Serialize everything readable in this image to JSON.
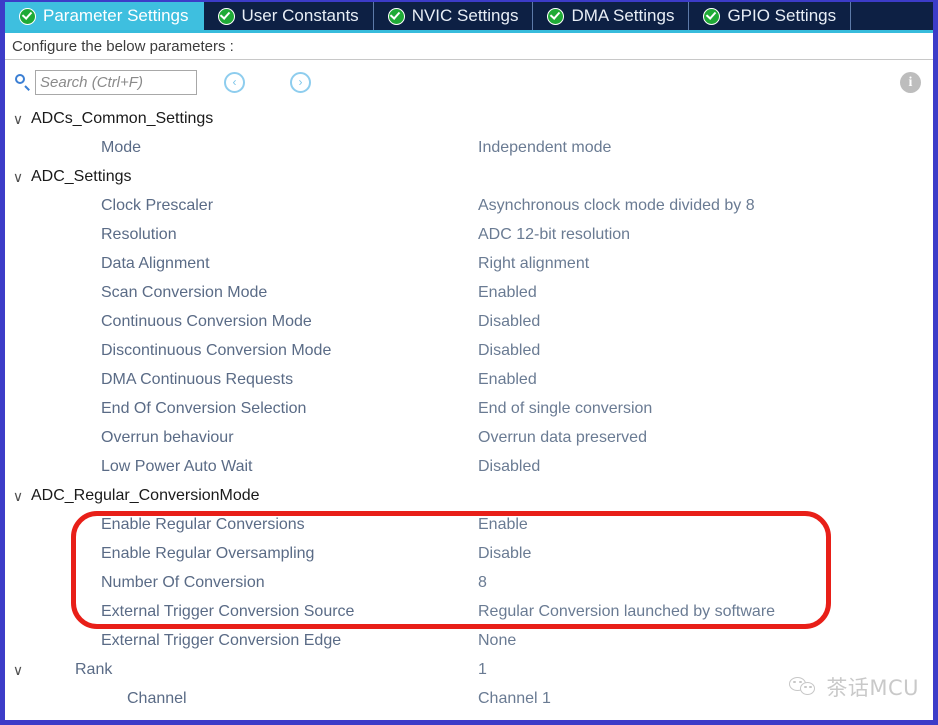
{
  "colors": {
    "active_tab_bg": "#3ebfdf",
    "tabbar_bg": "#0d2044",
    "window_border": "#3c3cc8",
    "annotation": "#e81f18",
    "group_label": "#1a1a1a",
    "child_label": "#5a6b86",
    "value_text": "#6a7b93"
  },
  "tabs": [
    {
      "label": "Parameter Settings",
      "icon": "check-circle-icon",
      "active": true
    },
    {
      "label": "User Constants",
      "icon": "check-circle-icon",
      "active": false
    },
    {
      "label": "NVIC Settings",
      "icon": "check-circle-icon",
      "active": false
    },
    {
      "label": "DMA Settings",
      "icon": "check-circle-icon",
      "active": false
    },
    {
      "label": "GPIO Settings",
      "icon": "check-circle-icon",
      "active": false
    }
  ],
  "configure": {
    "text": "Configure the below parameters :"
  },
  "search": {
    "placeholder": "Search (Ctrl+F)",
    "value": "",
    "icon": "search-icon",
    "prev_glyph": "‹",
    "next_glyph": "›",
    "info_glyph": "i"
  },
  "tree": [
    {
      "kind": "group",
      "label": "ADCs_Common_Settings",
      "chevron": "∨",
      "value": ""
    },
    {
      "kind": "child",
      "label": "Mode",
      "chevron": "",
      "value": "Independent mode"
    },
    {
      "kind": "group",
      "label": "ADC_Settings",
      "chevron": "∨",
      "value": ""
    },
    {
      "kind": "child",
      "label": "Clock Prescaler",
      "chevron": "",
      "value": "Asynchronous clock mode divided by 8"
    },
    {
      "kind": "child",
      "label": "Resolution",
      "chevron": "",
      "value": "ADC 12-bit resolution"
    },
    {
      "kind": "child",
      "label": "Data Alignment",
      "chevron": "",
      "value": "Right alignment"
    },
    {
      "kind": "child",
      "label": "Scan Conversion Mode",
      "chevron": "",
      "value": "Enabled"
    },
    {
      "kind": "child",
      "label": "Continuous Conversion Mode",
      "chevron": "",
      "value": "Disabled"
    },
    {
      "kind": "child",
      "label": "Discontinuous Conversion Mode",
      "chevron": "",
      "value": "Disabled"
    },
    {
      "kind": "child",
      "label": "DMA Continuous Requests",
      "chevron": "",
      "value": "Enabled"
    },
    {
      "kind": "child",
      "label": "End Of Conversion Selection",
      "chevron": "",
      "value": "End of single conversion"
    },
    {
      "kind": "child",
      "label": "Overrun behaviour",
      "chevron": "",
      "value": "Overrun data preserved"
    },
    {
      "kind": "child",
      "label": "Low Power Auto Wait",
      "chevron": "",
      "value": "Disabled"
    },
    {
      "kind": "group",
      "label": "ADC_Regular_ConversionMode",
      "chevron": "∨",
      "value": ""
    },
    {
      "kind": "child",
      "label": "Enable Regular Conversions",
      "chevron": "",
      "value": "Enable"
    },
    {
      "kind": "child",
      "label": "Enable Regular Oversampling",
      "chevron": "",
      "value": "Disable"
    },
    {
      "kind": "child",
      "label": "Number Of Conversion",
      "chevron": "",
      "value": "8"
    },
    {
      "kind": "child",
      "label": "External Trigger Conversion Source",
      "chevron": "",
      "value": "Regular Conversion launched by software"
    },
    {
      "kind": "child",
      "label": "External Trigger Conversion Edge",
      "chevron": "",
      "value": "None"
    },
    {
      "kind": "child2",
      "label": "Rank",
      "chevron": "∨",
      "value": "1"
    },
    {
      "kind": "child3",
      "label": "Channel",
      "chevron": "",
      "value": "Channel 1"
    }
  ],
  "watermark": {
    "text": "茶话MCU",
    "icon": "wechat-icon"
  }
}
